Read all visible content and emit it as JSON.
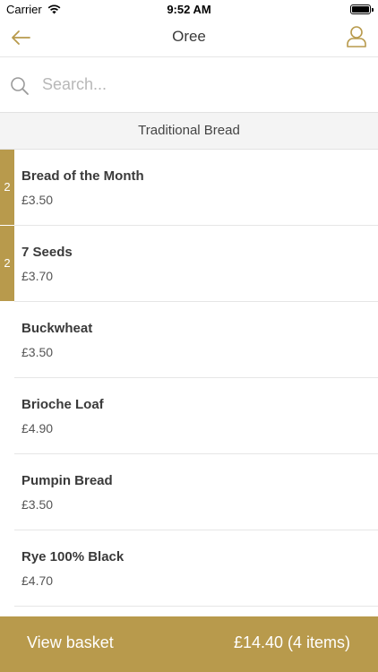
{
  "status_bar": {
    "carrier": "Carrier",
    "time": "9:52 AM"
  },
  "nav": {
    "title": "Oree"
  },
  "search": {
    "placeholder": "Search..."
  },
  "section": {
    "title": "Traditional Bread"
  },
  "products": [
    {
      "name": "Bread of the Month",
      "price": "£3.50",
      "qty": "2"
    },
    {
      "name": "7 Seeds",
      "price": "£3.70",
      "qty": "2"
    },
    {
      "name": "Buckwheat",
      "price": "£3.50",
      "qty": ""
    },
    {
      "name": "Brioche Loaf",
      "price": "£4.90",
      "qty": ""
    },
    {
      "name": "Pumpin Bread",
      "price": "£3.50",
      "qty": ""
    },
    {
      "name": "Rye 100% Black",
      "price": "£4.70",
      "qty": ""
    }
  ],
  "basket": {
    "label": "View basket",
    "total": "£14.40 (4 items)"
  },
  "colors": {
    "accent": "#b89a4c",
    "section_bg": "#f4f4f4",
    "text": "#3a3a3a"
  }
}
